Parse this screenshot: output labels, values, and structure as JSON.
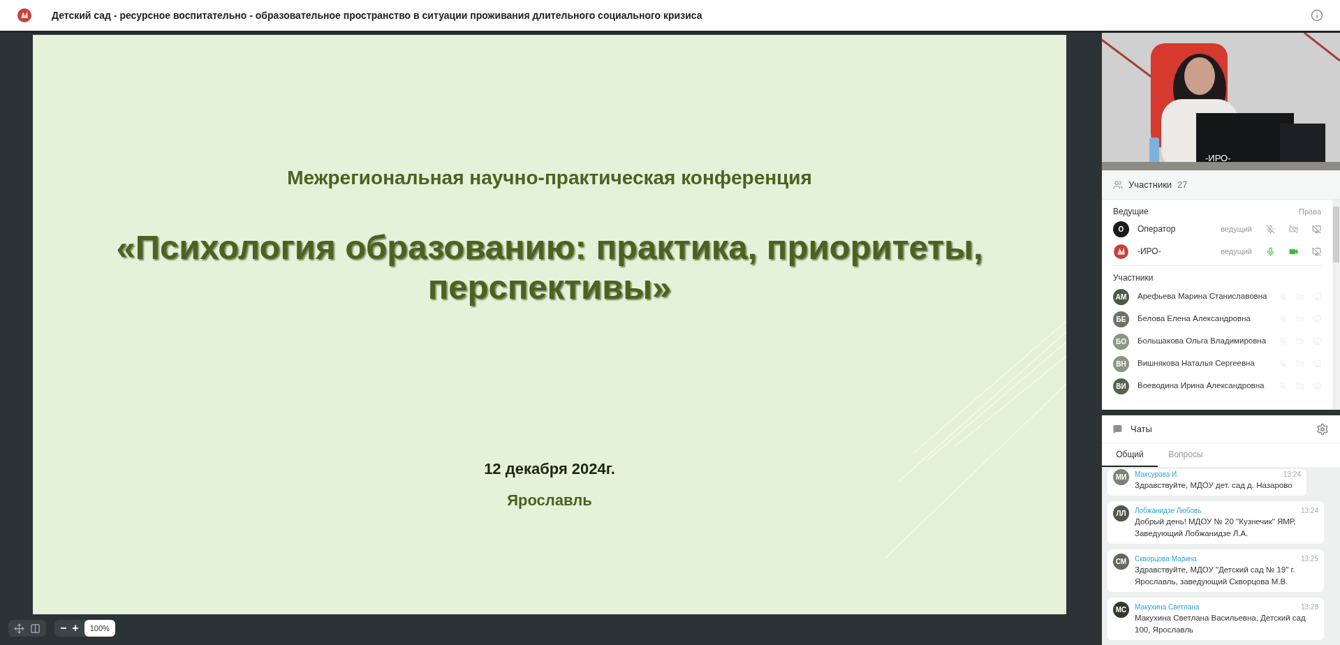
{
  "window": {
    "title": "Детский сад - ресурсное воспитательно - образовательное пространство в ситуации проживания длительного социального кризиса"
  },
  "slide": {
    "subtitle": "Межрегиональная научно-практическая конференция",
    "title": "«Психология образованию: практика, приоритеты, перспективы»",
    "date": "12 декабря 2024г.",
    "city": "Ярославль"
  },
  "zoom": {
    "value": "100%",
    "minus": "−",
    "plus": "+"
  },
  "video": {
    "label": "-ИРО-"
  },
  "participants": {
    "title": "Участники",
    "count": "27",
    "hosts_heading": "Ведущие",
    "rights": "Права",
    "hosts": [
      {
        "initials": "О",
        "name": "Оператор",
        "role": "ведущий",
        "kind": "initials",
        "mic_on": false,
        "cam_on": false
      },
      {
        "name": "-ИРО-",
        "role": "ведущий",
        "kind": "logo",
        "mic_on": true,
        "cam_on": true
      }
    ],
    "members_heading": "Участники",
    "members": [
      {
        "initials": "АМ",
        "name": "Арефьева Марина Станиславовна",
        "color": "#4d5848"
      },
      {
        "initials": "БЕ",
        "name": "Белова Елена Александровна",
        "color": "#6b7662"
      },
      {
        "initials": "БО",
        "name": "Большакова Ольга Владимировна",
        "color": "#8c9683"
      },
      {
        "initials": "ВН",
        "name": "Вишнякова Наталья Сергеевна",
        "color": "#8c9683"
      },
      {
        "initials": "ВИ",
        "name": "Воеводина Ирина Александровна",
        "color": "#58634f"
      }
    ]
  },
  "chat": {
    "title": "Чаты",
    "tabs": [
      {
        "label": "Общий",
        "selected": true
      },
      {
        "label": "Вопросы",
        "selected": false
      }
    ],
    "messages": [
      {
        "initials": "МИ",
        "author": "Максурова И.",
        "time": "13:24",
        "text": "Здравствуйте, МДОУ дет. сад д. Назарово",
        "color": "#7b8373"
      },
      {
        "initials": "ЛЛ",
        "author": "Лобжанидзе Любовь",
        "time": "13:24",
        "text": "Добрый день! МДОУ № 20 \"Кузнечик\" ЯМР, Заведующий Лобжанидзе Л.А.",
        "color": "#4d5848"
      },
      {
        "initials": "СМ",
        "author": "Скворцова Марина",
        "time": "13:25",
        "text": "Здравствуйте, МДОУ \"Детский сад № 19\" г. Ярославль, заведующий Скворцова М.В.",
        "color": "#5f6a58"
      },
      {
        "initials": "МС",
        "author": "Макухина Светлана",
        "time": "13:28",
        "text": "Макухина Светлана Васильевна, Детский сад 100, Ярославль",
        "color": "#2f3a2c"
      }
    ]
  }
}
